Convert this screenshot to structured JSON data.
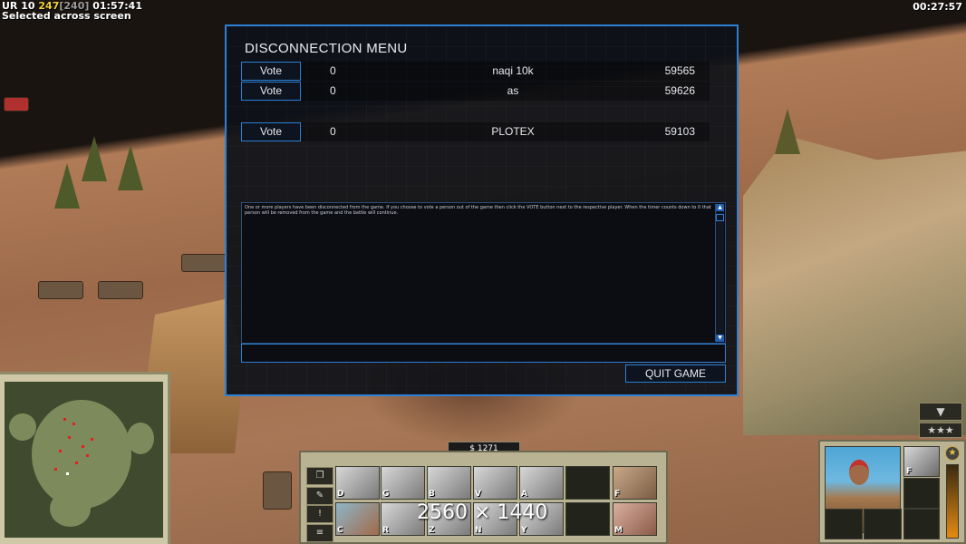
{
  "hud": {
    "ur_label": "UR",
    "ur_value": "10",
    "fps_current": "247",
    "fps_limit": "[240]",
    "game_time": "01:57:41",
    "selection_status": "Selected across screen",
    "real_clock": "00:27:57"
  },
  "disconnection_menu": {
    "title": "DISCONNECTION MENU",
    "players": [
      {
        "vote_label": "Vote",
        "votes": "0",
        "name": "naqi 10k",
        "ping": "59565"
      },
      {
        "vote_label": "Vote",
        "votes": "0",
        "name": "as",
        "ping": "59626"
      },
      {
        "vote_label": "Vote",
        "votes": "0",
        "name": "PLOTEX",
        "ping": "59103"
      }
    ],
    "message": "One or more players have been disconnected from the game. If you choose to vote a person out of the game then click the VOTE button next to the respective player. When the timer counts down to 0 that person will be removed from the game and the battle will continue.",
    "quit_label": "QUIT GAME"
  },
  "command_bar": {
    "money": "$ 1271",
    "build_slots": [
      {
        "hotkey": "D",
        "icon": "building-icon"
      },
      {
        "hotkey": "G",
        "icon": "barracks-icon"
      },
      {
        "hotkey": "B",
        "icon": "bunker-icon"
      },
      {
        "hotkey": "V",
        "icon": "factory-icon"
      },
      {
        "hotkey": "A",
        "icon": "airfield-icon"
      },
      {
        "hotkey": "F",
        "icon": "upgrade-icon"
      },
      {
        "hotkey": "C",
        "icon": "command-center-icon"
      },
      {
        "hotkey": "R",
        "icon": "silo-icon"
      },
      {
        "hotkey": "Z",
        "icon": "defense-icon"
      },
      {
        "hotkey": "N",
        "icon": "depot-icon"
      },
      {
        "hotkey": "Y",
        "icon": "tower-icon"
      },
      {
        "hotkey": "M",
        "icon": "wheel-icon"
      }
    ],
    "resolution_watermark": "2560 × 1440"
  },
  "unit_panel": {
    "secondary_slot_hotkey": "F",
    "rank_stars": "★★★"
  },
  "colors": {
    "accent": "#2b7fd6",
    "panel_bg": "#0e1118"
  }
}
